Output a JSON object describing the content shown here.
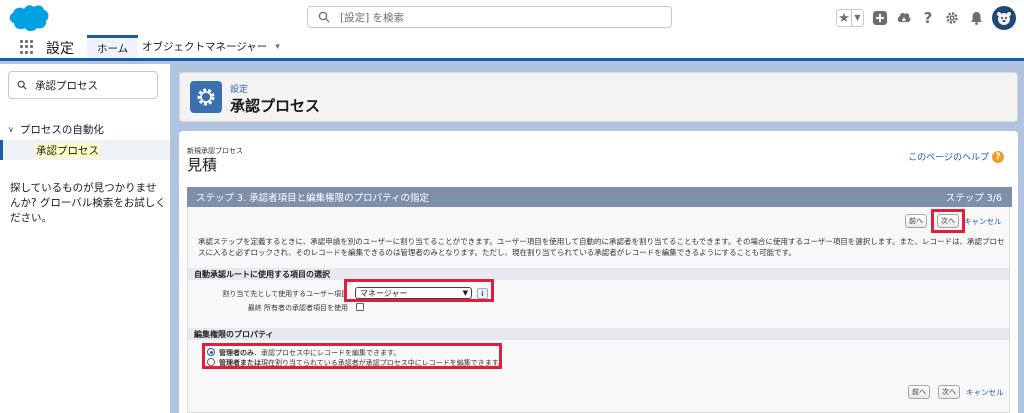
{
  "header": {
    "search_placeholder": "[設定] を検索"
  },
  "nav": {
    "app_name": "設定",
    "tabs": [
      {
        "label": "ホーム"
      },
      {
        "label": "オブジェクトマネージャー"
      }
    ]
  },
  "sidebar": {
    "search_value": "承認プロセス",
    "tree_parent": "プロセスの自動化",
    "tree_child": "承認プロセス",
    "help_text": "探しているものが見つかりませんか? グローバル検索をお試しください。"
  },
  "page_header": {
    "breadcrumb": "設定",
    "title": "承認プロセス"
  },
  "content": {
    "subtitle": "新規承認プロセス",
    "title": "見積",
    "help_link": "このページのヘルプ",
    "wizard": {
      "step_title": "ステップ 3. 承認者項目と編集権限のプロパティの指定",
      "step_count": "ステップ 3/6",
      "buttons": {
        "prev": "前へ",
        "next": "次へ",
        "cancel": "キャンセル"
      },
      "description": "承認ステップを定義するときに、承認申請を別のユーザーに割り当てることができます。ユーザー項目を使用して自動的に承認者を割り当てることもできます。その場合に使用するユーザー項目を選択します。また、レコードは、承認プロセスに入ると必ずロックされ、そのレコードを編集できるのは管理者のみとなります。ただし、現在割り当てられている承認者がレコードを編集できるようにすることも可能です。",
      "section1": {
        "heading": "自動承認ルートに使用する項目の選択",
        "field_label": "割り当て先として使用するユーザー項目",
        "field_value": "マネージャー",
        "checkbox_label": "最終 所有者の承認者項目を使用"
      },
      "section2": {
        "heading": "編集権限のプロパティ",
        "option1_bold": "管理者のみ",
        "option1_rest": "、承認プロセス中にレコードを編集できます。",
        "option2_bold": "管理者または",
        "option2_rest": "現在割り当てられている承認者が承認プロセス中にレコードを編集できます。"
      }
    }
  },
  "colors": {
    "brand": "#1b5aa6",
    "wizard_header": "#7f8fa9",
    "highlight_box": "#e0203a"
  }
}
